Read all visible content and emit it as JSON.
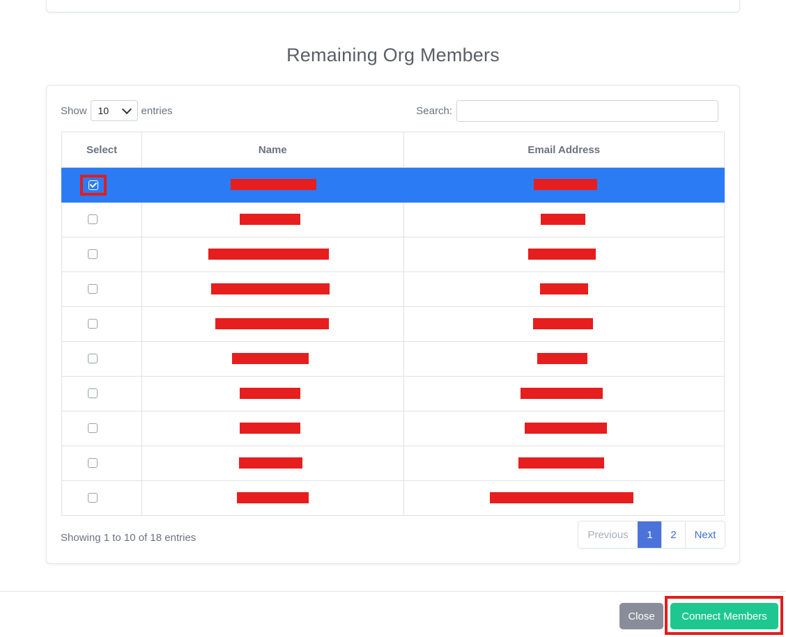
{
  "section": {
    "title": "Remaining Org Members"
  },
  "length_control": {
    "prefix": "Show",
    "value": "10",
    "suffix": "entries"
  },
  "search": {
    "label": "Search:",
    "value": ""
  },
  "table": {
    "headers": [
      "Select",
      "Name",
      "Email Address"
    ],
    "rows": [
      {
        "selected": true,
        "name_redacted": true,
        "email_redacted": true
      },
      {
        "selected": false,
        "name_redacted": true,
        "email_redacted": true
      },
      {
        "selected": false,
        "name_redacted": true,
        "email_redacted": true
      },
      {
        "selected": false,
        "name_redacted": true,
        "email_redacted": true
      },
      {
        "selected": false,
        "name_redacted": true,
        "email_redacted": true
      },
      {
        "selected": false,
        "name_redacted": true,
        "email_redacted": true
      },
      {
        "selected": false,
        "name_redacted": true,
        "email_redacted": true
      },
      {
        "selected": false,
        "name_redacted": true,
        "email_redacted": true
      },
      {
        "selected": false,
        "name_redacted": true,
        "email_redacted": true
      },
      {
        "selected": false,
        "name_redacted": true,
        "email_redacted": true
      }
    ]
  },
  "info": {
    "text": "Showing 1 to 10 of 18 entries"
  },
  "pagination": {
    "previous": "Previous",
    "pages": [
      "1",
      "2"
    ],
    "current": "1",
    "next": "Next"
  },
  "footer": {
    "close_label": "Close",
    "connect_label": "Connect Members"
  },
  "colors": {
    "selected_row": "#2b7bf5",
    "redaction": "#e61e1e",
    "highlight_box": "#e11d1d",
    "close_button": "#898d99",
    "connect_button": "#1fc790",
    "active_page": "#4b73d9"
  }
}
